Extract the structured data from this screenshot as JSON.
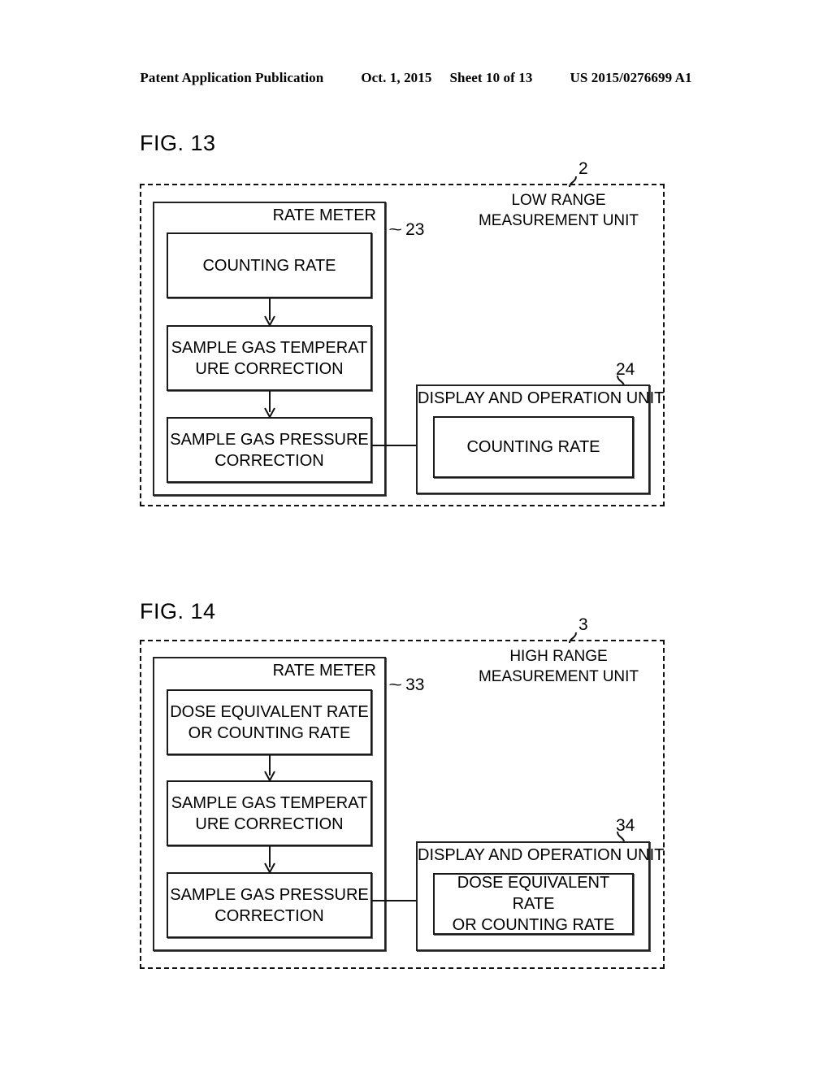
{
  "header": {
    "publication": "Patent Application Publication",
    "date": "Oct. 1, 2015",
    "sheet": "Sheet 10 of 13",
    "patent_number": "US 2015/0276699 A1"
  },
  "figures": [
    {
      "label": "FIG. 13",
      "unit_ref": "2",
      "unit_caption_line1": "LOW RANGE",
      "unit_caption_line2": "MEASUREMENT UNIT",
      "rate_meter": {
        "title": "RATE METER",
        "ref": "23",
        "steps": [
          "COUNTING RATE",
          "SAMPLE GAS TEMPERAT\nURE CORRECTION",
          "SAMPLE GAS PRESSURE\nCORRECTION"
        ]
      },
      "display_unit": {
        "title": "DISPLAY AND OPERATION UNIT",
        "ref": "24",
        "content": "COUNTING RATE"
      }
    },
    {
      "label": "FIG. 14",
      "unit_ref": "3",
      "unit_caption_line1": "HIGH RANGE",
      "unit_caption_line2": "MEASUREMENT UNIT",
      "rate_meter": {
        "title": "RATE METER",
        "ref": "33",
        "steps": [
          "DOSE EQUIVALENT RATE\nOR COUNTING RATE",
          "SAMPLE GAS TEMPERAT\nURE CORRECTION",
          "SAMPLE GAS PRESSURE\nCORRECTION"
        ]
      },
      "display_unit": {
        "title": "DISPLAY AND OPERATION UNIT",
        "ref": "34",
        "content": "DOSE EQUIVALENT RATE\nOR COUNTING RATE"
      }
    }
  ],
  "colors": {
    "ink": "#111111",
    "paper": "#ffffff"
  }
}
